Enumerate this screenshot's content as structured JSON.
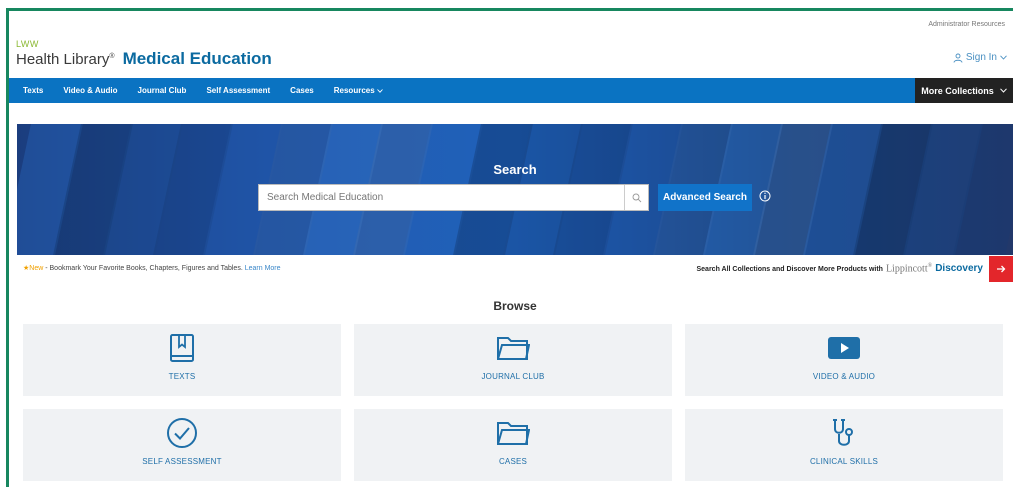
{
  "header": {
    "admin_link": "Administrator Resources",
    "brand_small": "LWW",
    "brand_name": "Health Library",
    "brand_mark": "®",
    "product_name": "Medical Education",
    "signin_label": "Sign In"
  },
  "nav": {
    "items": [
      {
        "label": "Texts"
      },
      {
        "label": "Video & Audio"
      },
      {
        "label": "Journal Club"
      },
      {
        "label": "Self Assessment"
      },
      {
        "label": "Cases"
      },
      {
        "label": "Resources"
      }
    ],
    "more_collections": "More Collections"
  },
  "hero": {
    "title": "Search",
    "search_placeholder": "Search Medical Education",
    "advanced_search": "Advanced Search"
  },
  "announcement": {
    "new_label": "New",
    "text": " - Bookmark Your Favorite Books, Chapters, Figures and Tables. ",
    "learn_more": "Learn More",
    "right_text": "Search All Collections and Discover More Products with",
    "lippincott": "Lippincott",
    "reg": "®",
    "discovery": "Discovery"
  },
  "browse": {
    "title": "Browse",
    "tiles": [
      {
        "label": "TEXTS",
        "icon": "book-icon"
      },
      {
        "label": "JOURNAL CLUB",
        "icon": "folder-icon"
      },
      {
        "label": "VIDEO & AUDIO",
        "icon": "play-icon"
      },
      {
        "label": "SELF ASSESSMENT",
        "icon": "check-circle-icon"
      },
      {
        "label": "CASES",
        "icon": "folder-icon"
      },
      {
        "label": "CLINICAL SKILLS",
        "icon": "stethoscope-icon"
      }
    ]
  },
  "colors": {
    "nav_bg": "#0a73c2",
    "brand_blue": "#0b6aa0",
    "accent_green": "#17875f",
    "more_collections_bg": "#222222",
    "discovery_button": "#e3262b",
    "tile_bg": "#f0f2f4",
    "icon_blue": "#1f6fa8"
  }
}
